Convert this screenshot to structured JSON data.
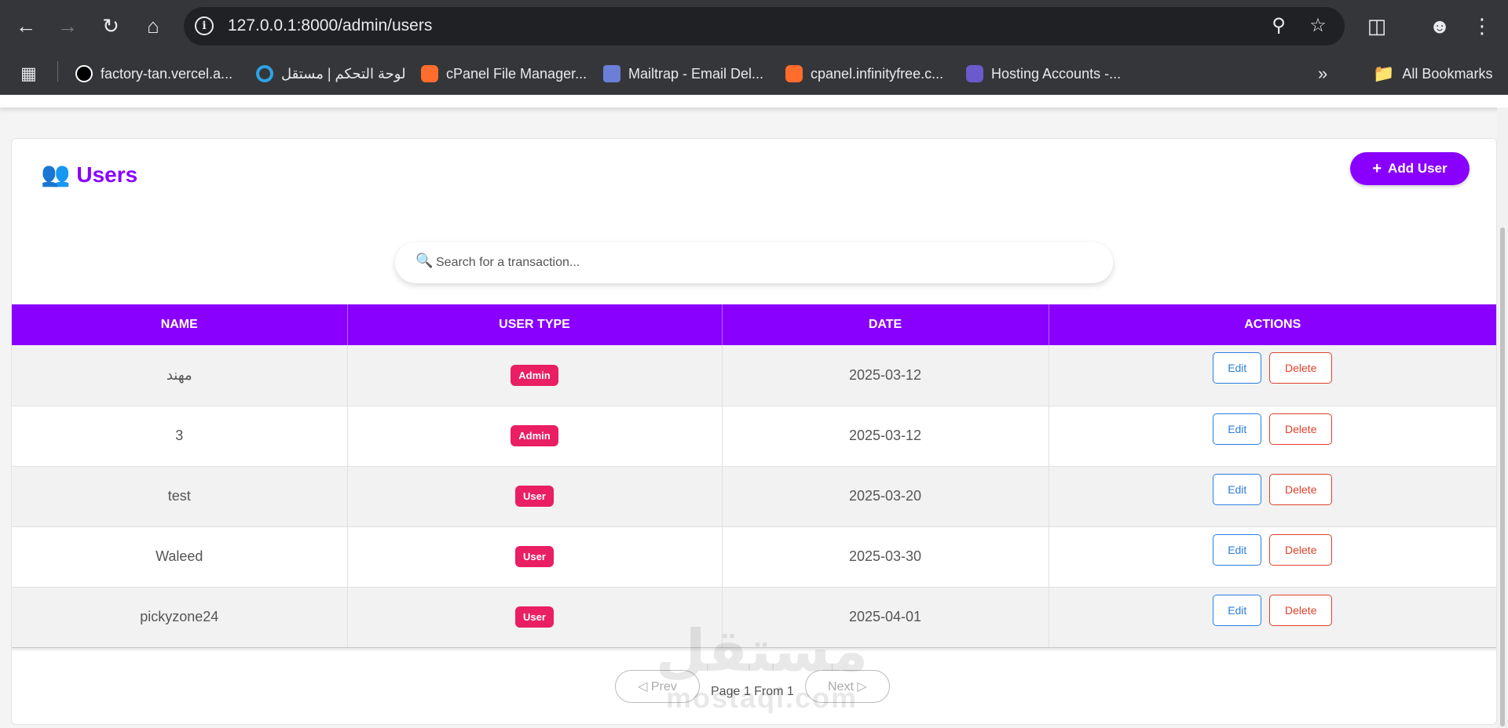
{
  "browser": {
    "url": "127.0.0.1:8000/admin/users",
    "bookmarks": [
      {
        "label": "factory-tan.vercel.a...",
        "color": "#ffffff"
      },
      {
        "label": "لوحة التحكم | مستقل",
        "color": "#2ea3e6"
      },
      {
        "label": "cPanel File Manager...",
        "color": "#ff6c2c"
      },
      {
        "label": "Mailtrap - Email Del...",
        "color": "#6b7fd7"
      },
      {
        "label": "cpanel.infinityfree.c...",
        "color": "#ff6c2c"
      },
      {
        "label": "Hosting Accounts -...",
        "color": "#6a5acd"
      }
    ],
    "all_bookmarks": "All Bookmarks"
  },
  "page": {
    "title": "Users",
    "add_button": "Add User",
    "search_placeholder": "Search for a transaction..."
  },
  "table": {
    "headers": [
      "NAME",
      "USER TYPE",
      "DATE",
      "ACTIONS"
    ],
    "rows": [
      {
        "name": "مهند",
        "type": "Admin",
        "date": "2025-03-12"
      },
      {
        "name": "3",
        "type": "Admin",
        "date": "2025-03-12"
      },
      {
        "name": "test",
        "type": "User",
        "date": "2025-03-20"
      },
      {
        "name": "Waleed",
        "type": "User",
        "date": "2025-03-30"
      },
      {
        "name": "pickyzone24",
        "type": "User",
        "date": "2025-04-01"
      }
    ],
    "edit_label": "Edit",
    "delete_label": "Delete"
  },
  "pagination": {
    "prev": "◁ Prev",
    "next": "Next ▷",
    "info": "Page 1 From 1"
  },
  "watermark": {
    "arabic": "مستقل",
    "latin": "mostaql.com"
  },
  "colors": {
    "brand": "#8a00ff",
    "badge": "#e91e63",
    "edit": "#2a7de1",
    "delete": "#e0402a"
  }
}
